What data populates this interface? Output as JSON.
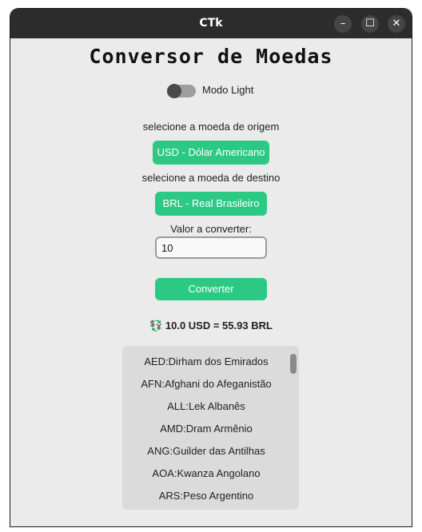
{
  "window": {
    "title": "CTk",
    "controls": {
      "minimize": "–",
      "maximize": "☐",
      "close": "✕"
    }
  },
  "heading": "Conversor de Moedas",
  "theme_switch": {
    "label": "Modo Light",
    "on": false
  },
  "origin": {
    "label": "selecione a moeda de origem",
    "value": "USD - Dólar Americano"
  },
  "destination": {
    "label": "selecione a moeda de destino",
    "value": "BRL - Real Brasileiro"
  },
  "amount": {
    "label": "Valor a converter:",
    "value": "10"
  },
  "convert_button": "Converter",
  "result": {
    "icon": "💱",
    "text": "10.0 USD = 55.93 BRL"
  },
  "currency_list": [
    "AED:Dirham dos Emirados",
    "AFN:Afghani do Afeganistão",
    "ALL:Lek Albanês",
    "AMD:Dram Armênio",
    "ANG:Guilder das Antilhas",
    "AOA:Kwanza Angolano",
    "ARS:Peso Argentino"
  ],
  "colors": {
    "accent": "#2cc985",
    "titlebar": "#2c2c2c",
    "background": "#ebebeb",
    "listbox": "#dbdbdb"
  }
}
